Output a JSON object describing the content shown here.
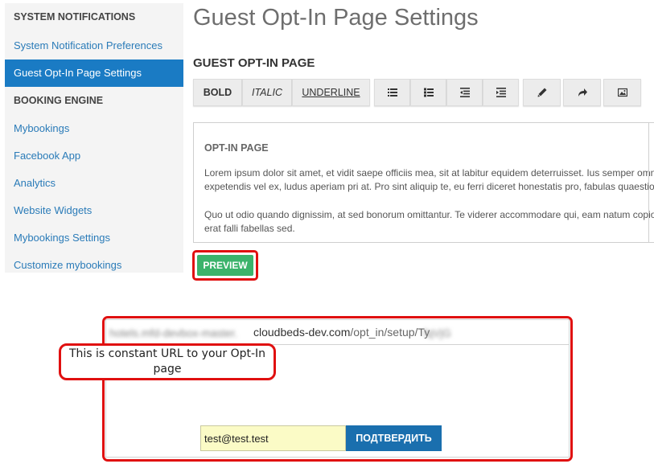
{
  "sidebar": {
    "sections": [
      {
        "header": "SYSTEM NOTIFICATIONS"
      },
      {
        "header": "BOOKING ENGINE"
      }
    ],
    "items": [
      {
        "label": "System Notification Preferences"
      },
      {
        "label": "Guest Opt-In Page Settings",
        "active": true
      },
      {
        "label": "Mybookings"
      },
      {
        "label": "Facebook App"
      },
      {
        "label": "Analytics"
      },
      {
        "label": "Website Widgets"
      },
      {
        "label": "Mybookings Settings"
      },
      {
        "label": "Customize mybookings"
      }
    ]
  },
  "main": {
    "title": "Guest Opt-In Page Settings",
    "section_title": "GUEST OPT-IN PAGE",
    "toolbar": {
      "bold": "BOLD",
      "italic": "ITALIC",
      "underline": "UNDERLINE",
      "icons": [
        "list-unordered-icon",
        "list-ordered-icon",
        "outdent-icon",
        "indent-icon",
        "pencil-icon",
        "redo-icon",
        "image-icon"
      ]
    },
    "editor": {
      "heading": "OPT-IN PAGE",
      "para1_line1": "Lorem ipsum dolor sit amet, et vidit saepe officiis mea, sit at labitur equidem deterruisset. Ius semper omnes",
      "para1_line2": "expetendis vel ex, ludus aperiam pri at. Pro sint aliquip te, eu ferri diceret honestatis pro, fabulas quaestio",
      "para2_line1": "Quo ut odio quando dignissim, at sed bonorum omittantur. Te viderer accommodare qui, eam natum copiosae",
      "para2_line2": "erat falli fabellas sed."
    },
    "preview_button": "PREVIEW"
  },
  "preview_frame": {
    "url_blurred_prefix": "hotels.mfd-devbox-master.",
    "url_domain": "cloudbeds-dev.com",
    "url_path": "/opt_in/setup/Ty",
    "url_blurred_suffix": "fqVjG",
    "callout": "This is constant URL to your Opt-In page",
    "email_value": "test@test.test",
    "confirm_button": "ПОДТВЕРДИТЬ"
  },
  "colors": {
    "accent": "#1a7bc4",
    "link": "#2a7bb8",
    "preview_green": "#3bb36b",
    "highlight_red": "#e01010",
    "email_bg": "#fbfbc6"
  }
}
